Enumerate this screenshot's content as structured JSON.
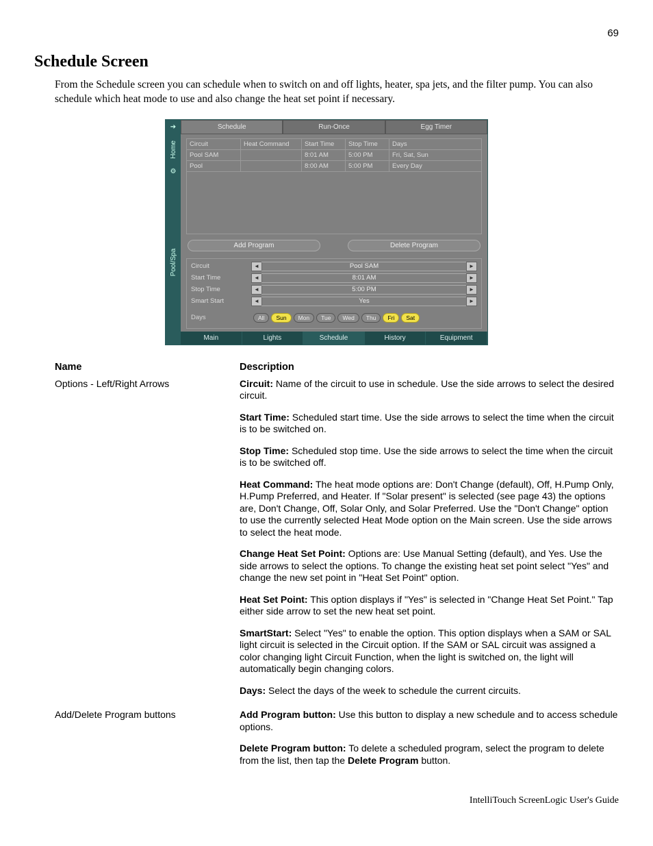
{
  "page_number": "69",
  "heading": "Schedule Screen",
  "intro": "From the Schedule screen you can schedule when to switch on and off lights, heater, spa jets, and the filter pump. You can also schedule which heat mode to use and also change the heat set point if necessary.",
  "app": {
    "left_tabs": {
      "home": "Home",
      "poolspa": "Pool/Spa"
    },
    "top_tabs": {
      "schedule": "Schedule",
      "runonce": "Run-Once",
      "eggtimer": "Egg Timer"
    },
    "grid_headers": {
      "circuit": "Circuit",
      "heat": "Heat Command",
      "start": "Start Time",
      "stop": "Stop Time",
      "days": "Days"
    },
    "grid_rows": [
      {
        "circuit": "Pool SAM",
        "heat": "",
        "start": "8:01  AM",
        "stop": "5:00  PM",
        "days": "Fri, Sat, Sun"
      },
      {
        "circuit": "Pool",
        "heat": "",
        "start": "8:00  AM",
        "stop": "5:00  PM",
        "days": "Every Day"
      }
    ],
    "buttons": {
      "add": "Add Program",
      "delete": "Delete Program"
    },
    "options": {
      "circuit": {
        "label": "Circuit",
        "value": "Pool SAM"
      },
      "start": {
        "label": "Start Time",
        "value": "8:01  AM"
      },
      "stop": {
        "label": "Stop Time",
        "value": "5:00  PM"
      },
      "smart": {
        "label": "Smart Start",
        "value": "Yes"
      }
    },
    "days": {
      "label": "Days",
      "items": [
        "All",
        "Sun",
        "Mon",
        "Tue",
        "Wed",
        "Thu",
        "Fri",
        "Sat"
      ],
      "selected": [
        "Sun",
        "Fri",
        "Sat"
      ]
    },
    "bottom_tabs": {
      "main": "Main",
      "lights": "Lights",
      "schedule": "Schedule",
      "history": "History",
      "equipment": "Equipment"
    }
  },
  "table": {
    "head_name": "Name",
    "head_desc": "Description",
    "rows": [
      {
        "name": "Options - Left/Right Arrows",
        "paras": [
          {
            "b": "Circuit:",
            "t": " Name of the circuit to use in schedule. Use the side arrows to select the desired circuit."
          },
          {
            "b": "Start Time:",
            "t": " Scheduled start time. Use the side arrows to select the time when the circuit is to be switched on."
          },
          {
            "b": "Stop Time:",
            "t": " Scheduled stop time. Use the side arrows to select the time when the circuit is to be switched off."
          },
          {
            "b": "Heat Command:",
            "t": " The heat mode options are:  Don't Change (default), Off, H.Pump Only, H.Pump Preferred, and Heater. If \"Solar present\" is selected (see page 43) the options are, Don't Change, Off, Solar Only, and Solar Preferred.  Use the \"Don't Change\" option to use the currently selected Heat Mode option on the Main screen. Use the side arrows to select the heat mode."
          },
          {
            "b": "Change Heat Set Point:",
            "t": " Options are: Use Manual Setting (default), and Yes. Use the side arrows to select the options. To change the existing heat set point select \"Yes\" and change the new set point in \"Heat Set Point\" option."
          },
          {
            "b": "Heat Set Point:",
            "t": " This option displays if \"Yes\" is selected in \"Change Heat Set Point.\" Tap either side arrow to set the new heat set point."
          },
          {
            "b": "SmartStart:",
            "t": " Select \"Yes\" to enable the option. This option displays when a SAM or SAL light circuit is selected in the Circuit option.  If the SAM or SAL circuit was assigned a color changing light Circuit Function, when the light is switched on, the light will automatically begin changing colors."
          },
          {
            "b": "Days:",
            "t": " Select the days of the week to schedule the current circuits."
          }
        ]
      },
      {
        "name": "Add/Delete Program buttons",
        "paras": [
          {
            "b": "Add Program button:",
            "t": " Use this button to display a new schedule and to access schedule options."
          },
          {
            "b": "Delete Program button:",
            "t": " To delete a scheduled program, select the program to delete from the list, then tap the  ",
            "b2": "Delete Program",
            "t2": " button."
          }
        ]
      }
    ]
  },
  "footer": "IntelliTouch ScreenLogic User's Guide"
}
